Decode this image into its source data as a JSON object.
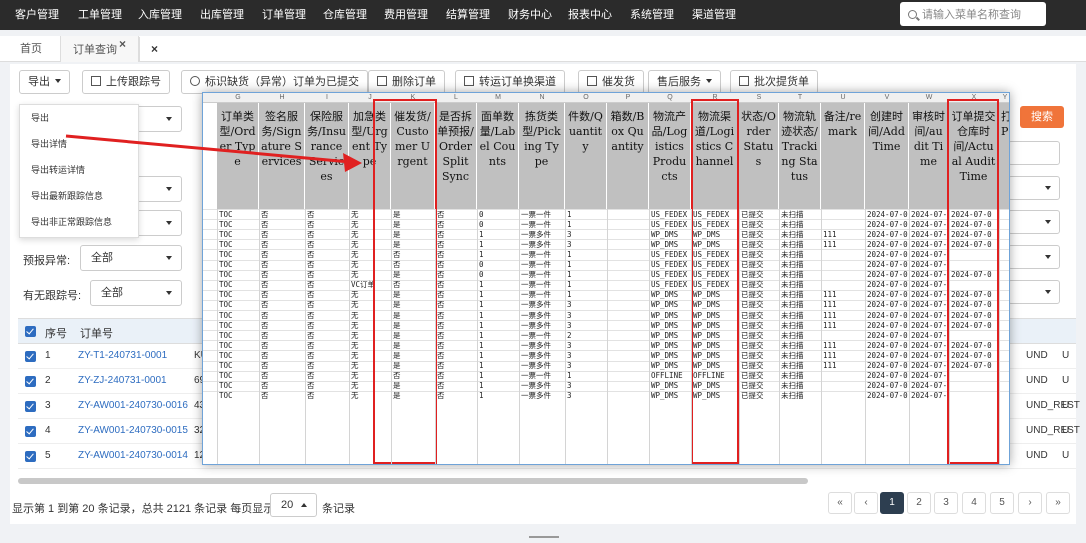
{
  "topnav": {
    "items": [
      "客户管理",
      "工单管理",
      "入库管理",
      "出库管理",
      "订单管理",
      "仓库管理",
      "费用管理",
      "结算管理",
      "财务中心",
      "报表中心",
      "系统管理",
      "渠道管理"
    ],
    "search_placeholder": "请输入菜单名称查询"
  },
  "tabs": {
    "home": "首页",
    "active": "订单查询",
    "active_close": "×",
    "close_all": "×"
  },
  "toolbar": {
    "export": "导出",
    "upload_tracking": "上传跟踪号",
    "mark_submitted": "标识缺货（异常）订单为已提交",
    "delete_order": "删除订单",
    "transfer": "转运订单换渠道",
    "urge": "催发货",
    "after_sales": "售后服务",
    "batch_tracking": "批次提货单"
  },
  "export_menu": [
    "导出",
    "导出详情",
    "导出转运详情",
    "导出最新跟踪信息",
    "导出非正常跟踪信息"
  ],
  "filters": {
    "forecast_exception_label": "预报异常:",
    "forecast_exception_value": "全部",
    "has_tracking_label": "有无跟踪号:",
    "has_tracking_value": "全部",
    "search_btn": "搜索"
  },
  "list": {
    "headers": {
      "seq": "序号",
      "order_no": "订单号"
    },
    "rows": [
      {
        "no": "1",
        "order": "ZY-T1-240731-0001",
        "p": "KU",
        "r": "UND",
        "r2": "U"
      },
      {
        "no": "2",
        "order": "ZY-ZJ-240731-0001",
        "p": "69",
        "r": "UND",
        "r2": "U"
      },
      {
        "no": "3",
        "order": "ZY-AW001-240730-0016",
        "p": "43",
        "r": "UND_REST",
        "r2": "U"
      },
      {
        "no": "4",
        "order": "ZY-AW001-240730-0015",
        "p": "32",
        "r": "UND_REST",
        "r2": "U"
      },
      {
        "no": "5",
        "order": "ZY-AW001-240730-0014",
        "p": "12",
        "r": "UND",
        "r2": "U"
      }
    ]
  },
  "footer": {
    "summary": "显示第 1 到第 20 条记录，总共 2121 条记录 每页显示",
    "page_size": "20",
    "unit": "条记录",
    "pages": [
      "«",
      "‹",
      "1",
      "2",
      "3",
      "4",
      "5",
      "›",
      "»"
    ]
  },
  "sheet": {
    "col_letters": [
      "G",
      "H",
      "I",
      "J",
      "K",
      "L",
      "M",
      "N",
      "O",
      "P",
      "Q",
      "R",
      "S",
      "T",
      "U",
      "V",
      "W",
      "X",
      "Y"
    ],
    "headers": [
      "订单类型/Order Type",
      "签名服务/Signature Services",
      "保险服务/Insurance Services",
      "加急类型/Urgent Type",
      "催发货/Customer Urgent",
      "是否拆单预报/Order Split Sync",
      "面单数量/Label Counts",
      "拣货类型/Picking Type",
      "件数/Quantity",
      "箱数/Box Quantity",
      "物流产品/Logistics Products",
      "物流渠道/Logistics Channel",
      "状态/Order Status",
      "物流轨迹状态/Tracking Status",
      "备注/remark",
      "创建时间/Add Time",
      "审核时间/audit Time",
      "订单提交仓库时间/Actual Audit Time",
      "打/P"
    ],
    "rows": [
      [
        "TOC",
        "否",
        "否",
        "无",
        "是",
        "否",
        "0",
        "一票一件",
        "1",
        "",
        "US_FEDEX",
        "US_FEDEX",
        "已提交",
        "未扫描",
        "",
        "2024-07-0",
        "2024-07-0",
        "2024-07-0"
      ],
      [
        "TOC",
        "否",
        "否",
        "无",
        "是",
        "否",
        "0",
        "一票一件",
        "1",
        "",
        "US_FEDEX",
        "US_FEDEX",
        "已提交",
        "未扫描",
        "",
        "2024-07-0",
        "2024-07-0",
        "2024-07-0"
      ],
      [
        "TOC",
        "否",
        "否",
        "无",
        "是",
        "否",
        "1",
        "一票多件",
        "3",
        "",
        "WP_DMS",
        "WP_DMS",
        "已提交",
        "未扫描",
        "111",
        "2024-07-0",
        "2024-07-0",
        "2024-07-0"
      ],
      [
        "TOC",
        "否",
        "否",
        "无",
        "是",
        "否",
        "1",
        "一票多件",
        "3",
        "",
        "WP_DMS",
        "WP_DMS",
        "已提交",
        "未扫描",
        "111",
        "2024-07-0",
        "2024-07-0",
        "2024-07-0"
      ],
      [
        "TOC",
        "否",
        "否",
        "无",
        "否",
        "否",
        "1",
        "一票一件",
        "1",
        "",
        "US_FEDEX",
        "US_FEDEX",
        "已提交",
        "未扫描",
        "",
        "2024-07-0",
        "2024-07-0",
        ""
      ],
      [
        "TOC",
        "否",
        "否",
        "无",
        "否",
        "否",
        "0",
        "一票一件",
        "1",
        "",
        "US_FEDEX",
        "US_FEDEX",
        "已提交",
        "未扫描",
        "",
        "2024-07-0",
        "2024-07-0",
        ""
      ],
      [
        "TOC",
        "否",
        "否",
        "无",
        "是",
        "否",
        "0",
        "一票一件",
        "1",
        "",
        "US_FEDEX",
        "US_FEDEX",
        "已提交",
        "未扫描",
        "",
        "2024-07-0",
        "2024-07-0",
        "2024-07-0"
      ],
      [
        "TOC",
        "否",
        "否",
        "VC订单",
        "否",
        "否",
        "1",
        "一票一件",
        "1",
        "",
        "US_FEDEX",
        "US_FEDEX",
        "已提交",
        "未扫描",
        "",
        "2024-07-0",
        "2024-07-0",
        ""
      ],
      [
        "TOC",
        "否",
        "否",
        "无",
        "是",
        "否",
        "1",
        "一票一件",
        "1",
        "",
        "WP_DMS",
        "WP_DMS",
        "已提交",
        "未扫描",
        "111",
        "2024-07-0",
        "2024-07-0",
        "2024-07-0"
      ],
      [
        "TOC",
        "否",
        "否",
        "无",
        "是",
        "否",
        "1",
        "一票多件",
        "3",
        "",
        "WP_DMS",
        "WP_DMS",
        "已提交",
        "未扫描",
        "111",
        "2024-07-0",
        "2024-07-0",
        "2024-07-0"
      ],
      [
        "TOC",
        "否",
        "否",
        "无",
        "是",
        "否",
        "1",
        "一票多件",
        "3",
        "",
        "WP_DMS",
        "WP_DMS",
        "已提交",
        "未扫描",
        "111",
        "2024-07-0",
        "2024-07-0",
        "2024-07-0"
      ],
      [
        "TOC",
        "否",
        "否",
        "无",
        "是",
        "否",
        "1",
        "一票多件",
        "3",
        "",
        "WP_DMS",
        "WP_DMS",
        "已提交",
        "未扫描",
        "111",
        "2024-07-0",
        "2024-07-0",
        "2024-07-0"
      ],
      [
        "TOC",
        "否",
        "否",
        "无",
        "是",
        "否",
        "1",
        "一票一件",
        "2",
        "",
        "WP_DMS",
        "WP_DMS",
        "已提交",
        "未扫描",
        "",
        "2024-07-0",
        "2024-07-0",
        ""
      ],
      [
        "TOC",
        "否",
        "否",
        "无",
        "是",
        "否",
        "1",
        "一票多件",
        "3",
        "",
        "WP_DMS",
        "WP_DMS",
        "已提交",
        "未扫描",
        "111",
        "2024-07-0",
        "2024-07-0",
        "2024-07-0"
      ],
      [
        "TOC",
        "否",
        "否",
        "无",
        "是",
        "否",
        "1",
        "一票多件",
        "3",
        "",
        "WP_DMS",
        "WP_DMS",
        "已提交",
        "未扫描",
        "111",
        "2024-07-0",
        "2024-07-0",
        "2024-07-0"
      ],
      [
        "TOC",
        "否",
        "否",
        "无",
        "是",
        "否",
        "1",
        "一票多件",
        "3",
        "",
        "WP_DMS",
        "WP_DMS",
        "已提交",
        "未扫描",
        "111",
        "2024-07-0",
        "2024-07-0",
        "2024-07-0"
      ],
      [
        "TOC",
        "否",
        "否",
        "无",
        "否",
        "否",
        "1",
        "一票一件",
        "1",
        "",
        "OFFLINE",
        "OFFLINE",
        "已提交",
        "未扫描",
        "",
        "2024-07-0",
        "2024-07-0",
        ""
      ],
      [
        "TOC",
        "否",
        "否",
        "无",
        "是",
        "否",
        "1",
        "一票多件",
        "3",
        "",
        "WP_DMS",
        "WP_DMS",
        "已提交",
        "未扫描",
        "",
        "2024-07-0",
        "2024-07-0",
        ""
      ],
      [
        "TOC",
        "否",
        "否",
        "无",
        "是",
        "否",
        "1",
        "一票多件",
        "3",
        "",
        "WP_DMS",
        "WP_DMS",
        "已提交",
        "未扫描",
        "",
        "2024-07-0",
        "2024-07-0",
        ""
      ]
    ]
  }
}
